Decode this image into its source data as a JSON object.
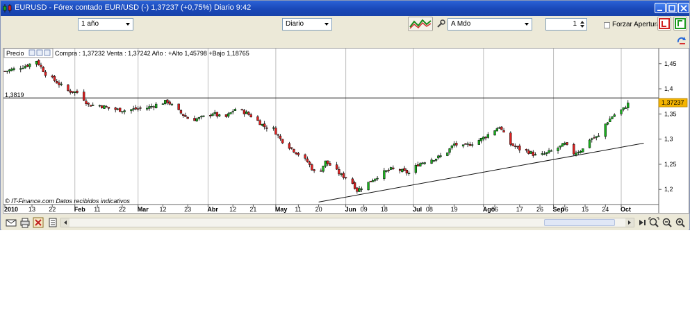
{
  "window": {
    "title": "EURUSD - Fórex contado EUR/USD (-)   1,37237 (+0,75%)   Diario  9:42"
  },
  "toolbar": {
    "period_value": "1 año",
    "interval_value": "Diario",
    "order_type_value": "A Mdo",
    "quantity_value": "1",
    "force_opening_label": "Forzar Apertura"
  },
  "chart_info": {
    "price_label": "Precio",
    "quote_text": "Compra : 1,37232 Venta : 1,37242  Año : +Alto 1,45798 +Bajo 1,18765",
    "source_text": "© IT-Finance.com  Datos recibidos indicativos",
    "hline_value_label": "1,3819",
    "last_price_label": "1,37237"
  },
  "chart_data": {
    "type": "candlestick",
    "title": "",
    "ylim": [
      1.17,
      1.48
    ],
    "ytick_labels": [
      "1,45",
      "1,4",
      "1,35",
      "1,3",
      "1,25",
      "1,2"
    ],
    "ytick_values": [
      1.45,
      1.4,
      1.35,
      1.3,
      1.25,
      1.2
    ],
    "xtick_labels": [
      {
        "label": "2010",
        "month": true,
        "d": 0
      },
      {
        "label": "13",
        "month": false,
        "d": 12
      },
      {
        "label": "22",
        "month": false,
        "d": 21
      },
      {
        "label": "Feb",
        "month": true,
        "d": 31
      },
      {
        "label": "11",
        "month": false,
        "d": 41
      },
      {
        "label": "22",
        "month": false,
        "d": 52
      },
      {
        "label": "Mar",
        "month": true,
        "d": 59
      },
      {
        "label": "12",
        "month": false,
        "d": 70
      },
      {
        "label": "23",
        "month": false,
        "d": 81
      },
      {
        "label": "Abr",
        "month": true,
        "d": 90
      },
      {
        "label": "12",
        "month": false,
        "d": 101
      },
      {
        "label": "21",
        "month": false,
        "d": 110
      },
      {
        "label": "May",
        "month": true,
        "d": 120
      },
      {
        "label": "11",
        "month": false,
        "d": 130
      },
      {
        "label": "20",
        "month": false,
        "d": 139
      },
      {
        "label": "Jun",
        "month": true,
        "d": 151
      },
      {
        "label": "09",
        "month": false,
        "d": 159
      },
      {
        "label": "18",
        "month": false,
        "d": 168
      },
      {
        "label": "Jul",
        "month": true,
        "d": 181
      },
      {
        "label": "08",
        "month": false,
        "d": 188
      },
      {
        "label": "19",
        "month": false,
        "d": 199
      },
      {
        "label": "Ago",
        "month": true,
        "d": 212
      },
      {
        "label": "06",
        "month": false,
        "d": 217
      },
      {
        "label": "17",
        "month": false,
        "d": 228
      },
      {
        "label": "26",
        "month": false,
        "d": 237
      },
      {
        "label": "Sep",
        "month": true,
        "d": 243
      },
      {
        "label": "06",
        "month": false,
        "d": 248
      },
      {
        "label": "15",
        "month": false,
        "d": 257
      },
      {
        "label": "24",
        "month": false,
        "d": 266
      },
      {
        "label": "Oct",
        "month": true,
        "d": 273
      }
    ],
    "month_gridlines_d": [
      31,
      59,
      90,
      120,
      151,
      181,
      212,
      243,
      273
    ],
    "horizontal_line": 1.3819,
    "trendline": {
      "start": {
        "d": 139,
        "y": 1.175
      },
      "end": {
        "d": 283,
        "y": 1.292
      }
    },
    "last_price": 1.37237,
    "series_close": [
      {
        "d": 0,
        "c": 1.435
      },
      {
        "d": 5,
        "c": 1.44
      },
      {
        "d": 10,
        "c": 1.447
      },
      {
        "d": 14,
        "c": 1.456
      },
      {
        "d": 18,
        "c": 1.43
      },
      {
        "d": 23,
        "c": 1.413
      },
      {
        "d": 28,
        "c": 1.396
      },
      {
        "d": 33,
        "c": 1.392
      },
      {
        "d": 37,
        "c": 1.368
      },
      {
        "d": 42,
        "c": 1.367
      },
      {
        "d": 47,
        "c": 1.36
      },
      {
        "d": 53,
        "c": 1.357
      },
      {
        "d": 58,
        "c": 1.36
      },
      {
        "d": 63,
        "c": 1.362
      },
      {
        "d": 68,
        "c": 1.37
      },
      {
        "d": 72,
        "c": 1.375
      },
      {
        "d": 77,
        "c": 1.355
      },
      {
        "d": 82,
        "c": 1.338
      },
      {
        "d": 87,
        "c": 1.342
      },
      {
        "d": 92,
        "c": 1.352
      },
      {
        "d": 97,
        "c": 1.34
      },
      {
        "d": 102,
        "c": 1.36
      },
      {
        "d": 107,
        "c": 1.352
      },
      {
        "d": 111,
        "c": 1.34
      },
      {
        "d": 115,
        "c": 1.325
      },
      {
        "d": 119,
        "c": 1.32
      },
      {
        "d": 122,
        "c": 1.3
      },
      {
        "d": 126,
        "c": 1.285
      },
      {
        "d": 130,
        "c": 1.27
      },
      {
        "d": 134,
        "c": 1.255
      },
      {
        "d": 137,
        "c": 1.235
      },
      {
        "d": 140,
        "c": 1.24
      },
      {
        "d": 142,
        "c": 1.255
      },
      {
        "d": 145,
        "c": 1.245
      },
      {
        "d": 149,
        "c": 1.228
      },
      {
        "d": 153,
        "c": 1.22
      },
      {
        "d": 156,
        "c": 1.198
      },
      {
        "d": 160,
        "c": 1.21
      },
      {
        "d": 163,
        "c": 1.22
      },
      {
        "d": 167,
        "c": 1.232
      },
      {
        "d": 171,
        "c": 1.24
      },
      {
        "d": 175,
        "c": 1.238
      },
      {
        "d": 179,
        "c": 1.232
      },
      {
        "d": 183,
        "c": 1.25
      },
      {
        "d": 187,
        "c": 1.258
      },
      {
        "d": 191,
        "c": 1.262
      },
      {
        "d": 195,
        "c": 1.27
      },
      {
        "d": 199,
        "c": 1.29
      },
      {
        "d": 203,
        "c": 1.285
      },
      {
        "d": 207,
        "c": 1.292
      },
      {
        "d": 211,
        "c": 1.3
      },
      {
        "d": 215,
        "c": 1.312
      },
      {
        "d": 219,
        "c": 1.325
      },
      {
        "d": 221,
        "c": 1.31
      },
      {
        "d": 224,
        "c": 1.29
      },
      {
        "d": 228,
        "c": 1.28
      },
      {
        "d": 232,
        "c": 1.275
      },
      {
        "d": 236,
        "c": 1.265
      },
      {
        "d": 240,
        "c": 1.272
      },
      {
        "d": 244,
        "c": 1.28
      },
      {
        "d": 248,
        "c": 1.29
      },
      {
        "d": 252,
        "c": 1.272
      },
      {
        "d": 256,
        "c": 1.28
      },
      {
        "d": 259,
        "c": 1.3
      },
      {
        "d": 263,
        "c": 1.305
      },
      {
        "d": 266,
        "c": 1.33
      },
      {
        "d": 269,
        "c": 1.345
      },
      {
        "d": 271,
        "c": 1.352
      },
      {
        "d": 274,
        "c": 1.36
      },
      {
        "d": 276,
        "c": 1.37
      }
    ]
  }
}
